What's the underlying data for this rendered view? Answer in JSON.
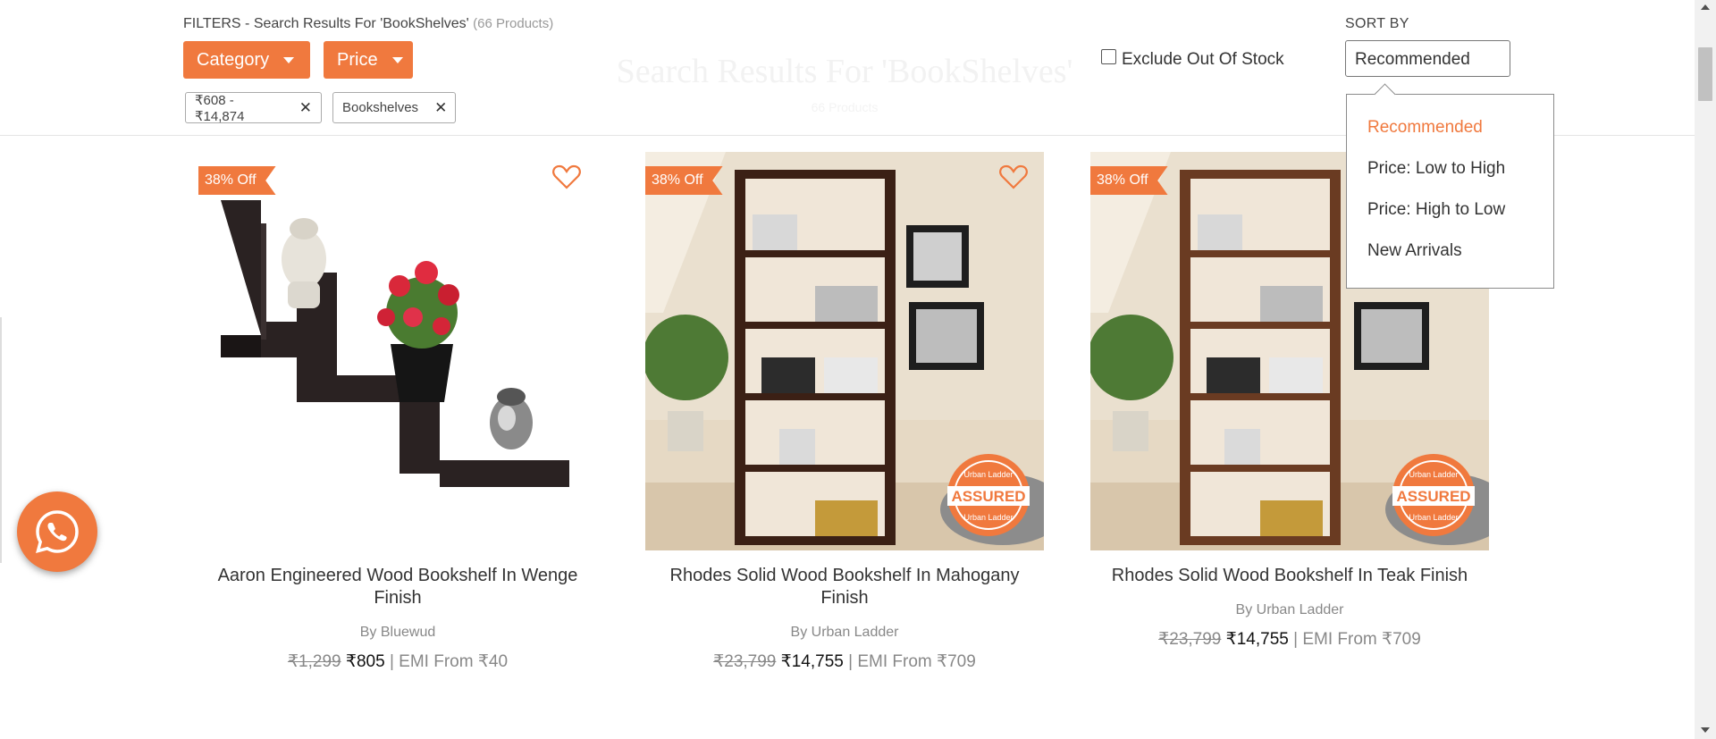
{
  "page": {
    "ghost_title": "Search Results For 'BookShelves'",
    "ghost_subtitle": "66 Products"
  },
  "filters": {
    "title": "FILTERS - Search Results For 'BookShelves'",
    "count": "(66 Products)",
    "category_label": "Category",
    "price_label": "Price",
    "chips": [
      {
        "label": "₹608 - ₹14,874"
      },
      {
        "label": "Bookshelves"
      }
    ],
    "exclude_label": "Exclude Out Of Stock",
    "exclude_checked": false
  },
  "sort": {
    "label": "SORT BY",
    "selected": "Recommended",
    "options": [
      "Recommended",
      "Price: Low to High",
      "Price: High to Low",
      "New Arrivals"
    ]
  },
  "products": [
    {
      "discount": "38% Off",
      "name": "Aaron Engineered Wood Bookshelf In Wenge Finish",
      "brand": "By Bluewud",
      "old_price": "₹1,299",
      "price": "₹805",
      "emi": "| EMI From ₹40",
      "assured": false
    },
    {
      "discount": "38% Off",
      "name": "Rhodes Solid Wood Bookshelf In Mahogany Finish",
      "brand": "By Urban Ladder",
      "old_price": "₹23,799",
      "price": "₹14,755",
      "emi": "| EMI From ₹709",
      "assured": true
    },
    {
      "discount": "38% Off",
      "name": "Rhodes Solid Wood Bookshelf In Teak Finish",
      "brand": "By Urban Ladder",
      "old_price": "₹23,799",
      "price": "₹14,755",
      "emi": "| EMI From ₹709",
      "assured": true
    }
  ],
  "assured_badge": {
    "top": "Urban Ladder",
    "middle": "ASSURED",
    "bottom": "Urban Ladder"
  },
  "colors": {
    "accent": "#f0793e",
    "text": "#333333",
    "muted": "#888888"
  }
}
